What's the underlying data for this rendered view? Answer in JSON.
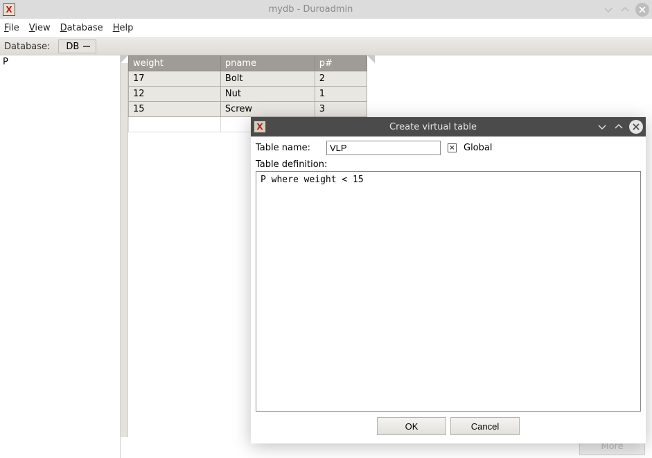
{
  "window": {
    "title": "mydb - Duroadmin"
  },
  "menu": {
    "file": "File",
    "view": "View",
    "database": "Database",
    "help": "Help"
  },
  "toolbar": {
    "db_label": "Database:",
    "db_value": "DB"
  },
  "sidebar": {
    "items": [
      "P"
    ]
  },
  "table": {
    "headers": [
      "weight",
      "pname",
      "p#"
    ],
    "rows": [
      {
        "weight": "17",
        "pname": "Bolt",
        "pnum": "2"
      },
      {
        "weight": "12",
        "pname": "Nut",
        "pnum": "1"
      },
      {
        "weight": "15",
        "pname": "Screw",
        "pnum": "3"
      }
    ]
  },
  "main": {
    "more_label": "More"
  },
  "dialog": {
    "title": "Create virtual table",
    "name_label": "Table name:",
    "name_value": "VLP",
    "global_label": "Global",
    "global_checked": "×",
    "def_label": "Table definition:",
    "def_value": "P where weight < 15",
    "ok_label": "OK",
    "cancel_label": "Cancel"
  }
}
